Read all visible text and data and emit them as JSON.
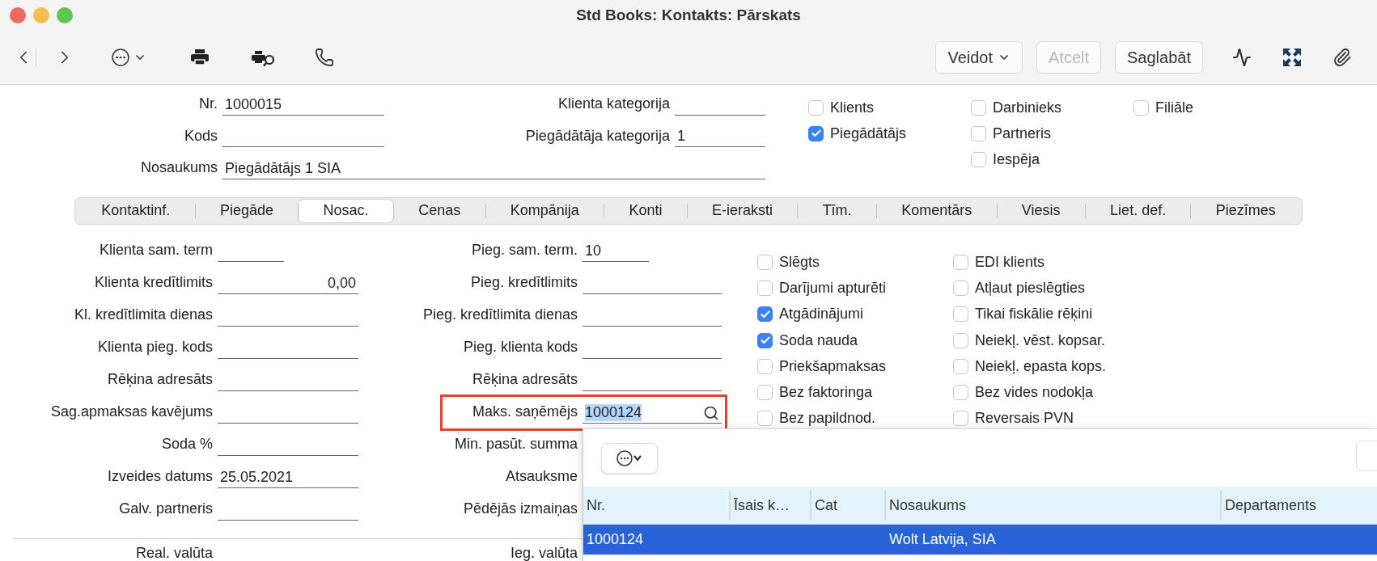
{
  "window": {
    "title": "Std Books: Kontakts: Pārskats"
  },
  "toolbar": {
    "buttons": [
      {
        "label": "Veidot",
        "kind": "menu",
        "disabled": false
      },
      {
        "label": "Atcelt",
        "kind": "plain",
        "disabled": true
      },
      {
        "label": "Saglabāt",
        "kind": "plain",
        "disabled": false
      }
    ]
  },
  "header": {
    "left_fields": [
      {
        "label": "Nr.",
        "value": "1000015"
      },
      {
        "label": "Kods"
      },
      {
        "label": "Nosaukums",
        "value": "Piegādātājs 1 SIA"
      }
    ],
    "right_fields": [
      {
        "label": "Klienta kategorija"
      },
      {
        "label": "Piegādātāja kategorija",
        "value": "1"
      }
    ],
    "checkbox_columns": [
      [
        {
          "label": "Klients",
          "checked": false
        },
        {
          "label": "Piegādātājs",
          "checked": true
        }
      ],
      [
        {
          "label": "Darbinieks",
          "checked": false
        },
        {
          "label": "Partneris",
          "checked": false
        },
        {
          "label": "Iespēja",
          "checked": false
        }
      ],
      [
        {
          "label": "Filiāle",
          "checked": false
        }
      ]
    ]
  },
  "tabs": [
    {
      "label": "Kontaktinf.",
      "selected": false
    },
    {
      "label": "Piegāde",
      "selected": false
    },
    {
      "label": "Nosac.",
      "selected": true
    },
    {
      "label": "Cenas",
      "selected": false
    },
    {
      "label": "Kompānija",
      "selected": false
    },
    {
      "label": "Konti",
      "selected": false
    },
    {
      "label": "E-ieraksti",
      "selected": false
    },
    {
      "label": "Tīm.",
      "selected": false
    },
    {
      "label": "Komentārs",
      "selected": false
    },
    {
      "label": "Viesis",
      "selected": false
    },
    {
      "label": "Liet. def.",
      "selected": false
    },
    {
      "label": "Piezīmes",
      "selected": false
    }
  ],
  "terms": {
    "left_fields": [
      {
        "label": "Klienta sam. term",
        "kind": "short"
      },
      {
        "label": "Klienta kredītlimits",
        "kind": "number",
        "value": "0,00"
      },
      {
        "label": "Kl. kredītlimita dienas",
        "kind": "text"
      },
      {
        "label": "Klienta pieg. kods",
        "kind": "text"
      },
      {
        "label": "Rēķina adresāts",
        "kind": "text"
      },
      {
        "label": "Sag.apmaksas kavējums",
        "kind": "text"
      },
      {
        "label": "Soda %",
        "kind": "text"
      },
      {
        "label": "Izveides datums",
        "kind": "text",
        "value": "25.05.2021"
      },
      {
        "label": "Galv. partneris",
        "kind": "text"
      }
    ],
    "right_fields": [
      {
        "label": "Pieg. sam. term.",
        "kind": "short",
        "value": "10"
      },
      {
        "label": "Pieg. kredītlimits",
        "kind": "text"
      },
      {
        "label": "Pieg. kredītlimita dienas",
        "kind": "text"
      },
      {
        "label": "Pieg. klienta kods",
        "kind": "text"
      },
      {
        "label": "Rēķina adresāts",
        "kind": "text"
      },
      {
        "label": "Maks. saņēmējs",
        "kind": "lookup",
        "value": "1000124",
        "highlighted": true
      },
      {
        "label": "Min. pasūt. summa",
        "kind": "covered"
      },
      {
        "label": "Atsauksme",
        "kind": "covered"
      },
      {
        "label": "Pēdējās izmaiņas",
        "kind": "covered"
      }
    ],
    "checkbox_columns": [
      [
        {
          "label": "Slēgts",
          "checked": false
        },
        {
          "label": "Darījumi apturēti",
          "checked": false
        },
        {
          "label": "Atgādinājumi",
          "checked": true
        },
        {
          "label": "Soda nauda",
          "checked": true
        },
        {
          "label": "Priekšapmaksas",
          "checked": false
        },
        {
          "label": "Bez faktoringa",
          "checked": false
        },
        {
          "label": "Bez papildnod.",
          "checked": false
        }
      ],
      [
        {
          "label": "EDI klients",
          "checked": false
        },
        {
          "label": "Atļaut pieslēgties",
          "checked": false
        },
        {
          "label": "Tikai fiskālie rēķini",
          "checked": false
        },
        {
          "label": "Neiekļ. vēst. kopsar.",
          "checked": false
        },
        {
          "label": "Neiekļ. epasta kops.",
          "checked": false
        },
        {
          "label": "Bez vides nodokļa",
          "checked": false
        },
        {
          "label": "Reversais PVN",
          "checked": false
        }
      ]
    ],
    "currency_labels": [
      "Real. valūta",
      "Ieg. valūta"
    ]
  },
  "lookup_popup": {
    "columns": [
      "Nr.",
      "Īsais k…",
      "Cat",
      "Nosaukums",
      "Departaments"
    ],
    "rows": [
      {
        "selected": true,
        "cells": [
          "1000124",
          null,
          null,
          "Wolt Latvija, SIA",
          null
        ]
      }
    ]
  }
}
